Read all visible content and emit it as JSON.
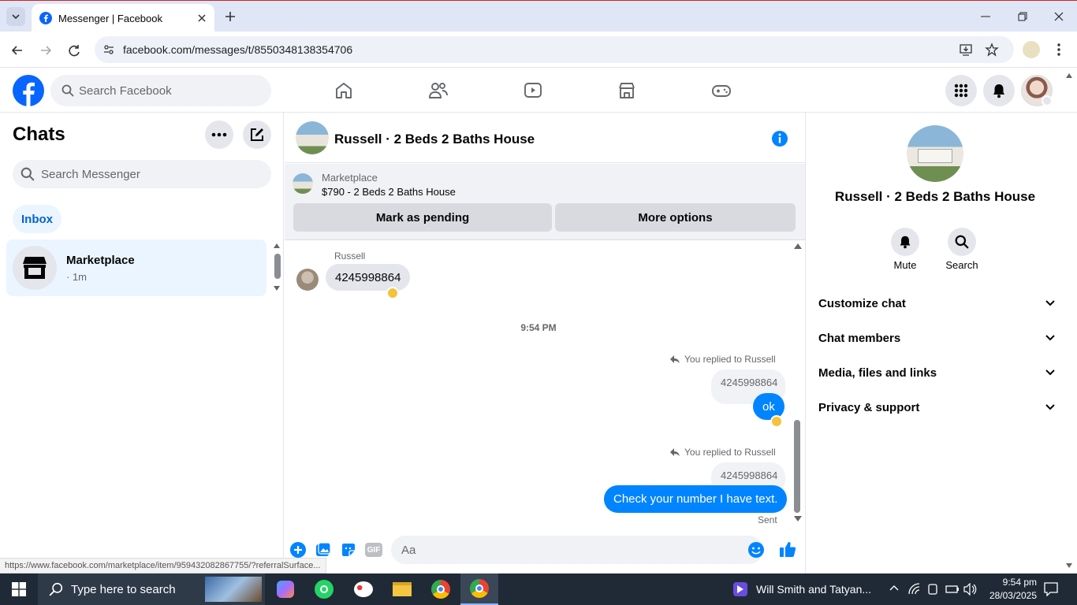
{
  "browser": {
    "tab_title": "Messenger | Facebook",
    "url": "facebook.com/messages/t/8550348138354706",
    "status_url": "https://www.facebook.com/marketplace/item/959432082867755/?referralSurface..."
  },
  "fbnav": {
    "search_placeholder": "Search Facebook"
  },
  "chats": {
    "title": "Chats",
    "search_placeholder": "Search Messenger",
    "inbox_label": "Inbox",
    "items": [
      {
        "name": "Marketplace",
        "meta": "· 1m"
      }
    ]
  },
  "conversation": {
    "title": "Russell · 2 Beds 2 Baths House",
    "listing": {
      "label": "Marketplace",
      "title": "$790 - 2 Beds 2 Baths House",
      "pending_button": "Mark as pending",
      "options_button": "More options"
    },
    "messages": {
      "incoming_sender": "Russell",
      "incoming_text": "4245998864",
      "timestamp": "9:54 PM",
      "reply1_label": "You replied to Russell",
      "reply1_quote": "4245998864",
      "reply1_text": "ok",
      "reply2_label": "You replied to Russell",
      "reply2_quote": "4245998864",
      "reply2_text": "Check your number I have text.",
      "status": "Sent"
    },
    "composer_placeholder": "Aa"
  },
  "details": {
    "name": "Russell · 2 Beds 2 Baths House",
    "actions": [
      {
        "label": "Mute",
        "icon": "bell-icon"
      },
      {
        "label": "Search",
        "icon": "search-icon"
      }
    ],
    "sections": [
      "Customize chat",
      "Chat members",
      "Media, files and links",
      "Privacy & support"
    ]
  },
  "taskbar": {
    "search_placeholder": "Type here to search",
    "media_title": "Will Smith and Tatyan...",
    "time": "9:54 pm",
    "date": "28/03/2025"
  },
  "colors": {
    "fb_blue": "#0866ff",
    "messenger_blue": "#0084ff",
    "taskbar": "#1f2a36"
  }
}
